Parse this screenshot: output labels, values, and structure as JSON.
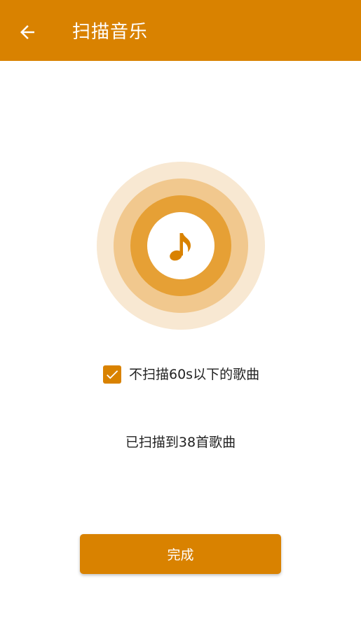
{
  "header": {
    "title": "扫描音乐",
    "back_icon": "arrow-left-icon"
  },
  "scan_graphic": {
    "icon": "music-note-icon"
  },
  "filter": {
    "checked": true,
    "label": "不扫描60s以下的歌曲"
  },
  "status": {
    "text": "已扫描到38首歌曲",
    "count": 38
  },
  "actions": {
    "done_label": "完成"
  },
  "colors": {
    "primary": "#D98200",
    "ring_outer": "#F8E8D2",
    "ring_mid": "#F1C88E",
    "ring_inner": "#E6A035"
  }
}
